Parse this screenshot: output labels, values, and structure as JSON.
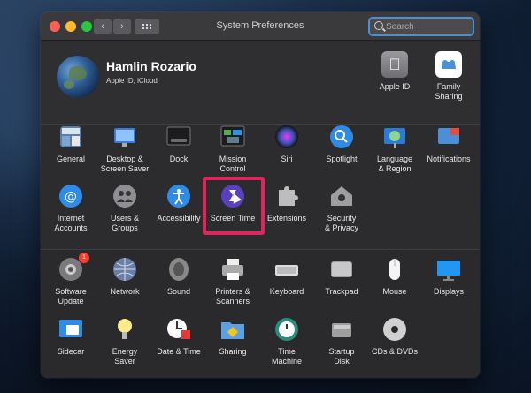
{
  "window": {
    "title": "System Preferences"
  },
  "search": {
    "placeholder": "Search"
  },
  "user": {
    "name": "Hamlin Rozario",
    "subtitle": "Apple ID, iCloud"
  },
  "top_right": [
    {
      "label": "Apple ID",
      "icon": "apple-id-icon"
    },
    {
      "label": "Family\nSharing",
      "icon": "family-sharing-icon"
    }
  ],
  "row1": [
    {
      "label": "General",
      "icon": "general-icon"
    },
    {
      "label": "Desktop &\nScreen Saver",
      "icon": "desktop-screensaver-icon"
    },
    {
      "label": "Dock",
      "icon": "dock-icon"
    },
    {
      "label": "Mission\nControl",
      "icon": "mission-control-icon"
    },
    {
      "label": "Siri",
      "icon": "siri-icon"
    },
    {
      "label": "Spotlight",
      "icon": "spotlight-icon"
    },
    {
      "label": "Language\n& Region",
      "icon": "language-region-icon"
    },
    {
      "label": "Notifications",
      "icon": "notifications-icon"
    }
  ],
  "row2": [
    {
      "label": "Internet\nAccounts",
      "icon": "internet-accounts-icon"
    },
    {
      "label": "Users &\nGroups",
      "icon": "users-groups-icon"
    },
    {
      "label": "Accessibility",
      "icon": "accessibility-icon"
    },
    {
      "label": "Screen Time",
      "icon": "screen-time-icon"
    },
    {
      "label": "Extensions",
      "icon": "extensions-icon"
    },
    {
      "label": "Security\n& Privacy",
      "icon": "security-privacy-icon"
    }
  ],
  "row3": [
    {
      "label": "Software\nUpdate",
      "icon": "software-update-icon",
      "badge": "1"
    },
    {
      "label": "Network",
      "icon": "network-icon"
    },
    {
      "label": "Sound",
      "icon": "sound-icon"
    },
    {
      "label": "Printers &\nScanners",
      "icon": "printers-scanners-icon"
    },
    {
      "label": "Keyboard",
      "icon": "keyboard-icon"
    },
    {
      "label": "Trackpad",
      "icon": "trackpad-icon"
    },
    {
      "label": "Mouse",
      "icon": "mouse-icon"
    },
    {
      "label": "Displays",
      "icon": "displays-icon"
    }
  ],
  "row4": [
    {
      "label": "Sidecar",
      "icon": "sidecar-icon"
    },
    {
      "label": "Energy\nSaver",
      "icon": "energy-saver-icon"
    },
    {
      "label": "Date & Time",
      "icon": "date-time-icon"
    },
    {
      "label": "Sharing",
      "icon": "sharing-icon"
    },
    {
      "label": "Time\nMachine",
      "icon": "time-machine-icon"
    },
    {
      "label": "Startup\nDisk",
      "icon": "startup-disk-icon"
    },
    {
      "label": "CDs & DVDs",
      "icon": "cds-dvds-icon"
    }
  ],
  "highlight_color": "#e0245e"
}
